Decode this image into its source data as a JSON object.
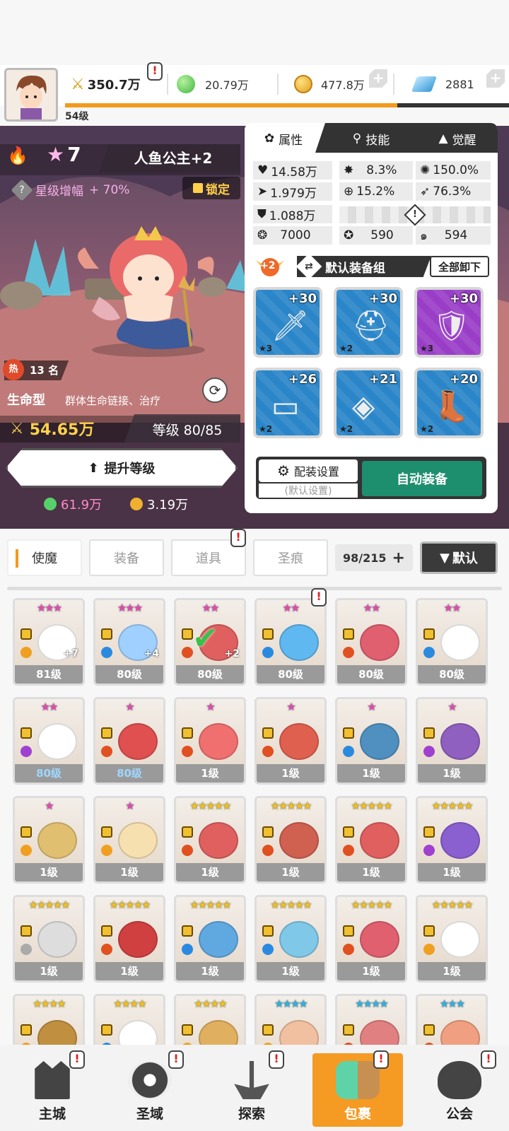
{
  "header": {
    "player_level": "54级",
    "power": "350.7万",
    "green_gem": "20.79万",
    "gold": "477.8万",
    "crystal": "2881",
    "xp_progress": 0.75,
    "accent_color": "#f39a1c"
  },
  "hero": {
    "stars": "7",
    "name": "人鱼公主+2",
    "star_boost_label": "星级增幅",
    "star_boost_value": "+ 70%",
    "lock_label": "锁定",
    "hot_label": "热",
    "hot_rank": "13 名",
    "type": "生命型",
    "description": "群体生命链接、治疗",
    "power": "54.65万",
    "level_label": "等级 80/85",
    "upgrade_label": "提升等级",
    "upgrade_cost_green": "61.9万",
    "upgrade_cost_gold": "3.19万"
  },
  "panel": {
    "tabs": [
      "属性",
      "技能",
      "觉醒"
    ],
    "stats": {
      "hp": "14.58万",
      "crit": "8.3%",
      "crit_dmg": "150.0%",
      "attack": "1.979万",
      "accuracy": "15.2%",
      "speed": "76.3%",
      "defense": "1.088万",
      "s1": "7000",
      "s2": "590",
      "s3": "594"
    },
    "equip_plus": "+2",
    "equip_group": "默认装备组",
    "unequip_all": "全部卸下",
    "slots": [
      {
        "level": "+30",
        "stars": "★3",
        "icon": "sword-icon",
        "color": "blue"
      },
      {
        "level": "+30",
        "stars": "★2",
        "icon": "helmet-icon",
        "color": "blue"
      },
      {
        "level": "+30",
        "stars": "★3",
        "icon": "armor-icon",
        "color": "purple"
      },
      {
        "level": "+26",
        "stars": "★2",
        "icon": "belt-icon",
        "color": "blue"
      },
      {
        "level": "+21",
        "stars": "★2",
        "icon": "necklace-icon",
        "color": "blue"
      },
      {
        "level": "+20",
        "stars": "★2",
        "icon": "boots-icon",
        "color": "blue"
      }
    ],
    "config_label": "配装设置",
    "config_sub": "(默认设置)",
    "auto_equip": "自动装备"
  },
  "category_tabs": [
    "使魔",
    "装备",
    "道具",
    "圣痕"
  ],
  "inventory_count": "98/215",
  "sort_label": "默认",
  "cards": [
    {
      "lv": "81级",
      "stars": "★★★",
      "star_color": "#e04ab0",
      "plus": "+7",
      "elem": "#f0a020",
      "face": "#ffffff"
    },
    {
      "lv": "80级",
      "stars": "★★★",
      "star_color": "#e04ab0",
      "plus": "+4",
      "elem": "#2a8ae0",
      "face": "#9fd0ff"
    },
    {
      "lv": "80级",
      "stars": "★★",
      "star_color": "#e04ab0",
      "plus": "+2",
      "elem": "#e05020",
      "face": "#e06060"
    },
    {
      "lv": "80级",
      "stars": "★★",
      "star_color": "#e04ab0",
      "plus": "",
      "elem": "#2a8ae0",
      "face": "#60b8f0"
    },
    {
      "lv": "80级",
      "stars": "★★",
      "star_color": "#e04ab0",
      "plus": "",
      "elem": "#e05020",
      "face": "#e06070"
    },
    {
      "lv": "80级",
      "stars": "★★",
      "star_color": "#e04ab0",
      "plus": "",
      "elem": "#2a8ae0",
      "face": "#ffffff"
    },
    {
      "lv": "80级",
      "stars": "★★",
      "star_color": "#e04ab0",
      "plus": "",
      "elem": "#a040d0",
      "face": "#ffffff",
      "blue": true
    },
    {
      "lv": "80级",
      "stars": "★",
      "star_color": "#e04ab0",
      "plus": "",
      "elem": "#e05020",
      "face": "#e05050",
      "blue": true
    },
    {
      "lv": "1级",
      "stars": "★",
      "star_color": "#e04ab0",
      "plus": "",
      "elem": "#e05020",
      "face": "#f07070"
    },
    {
      "lv": "1级",
      "stars": "★",
      "star_color": "#e04ab0",
      "plus": "",
      "elem": "#e05020",
      "face": "#e06050"
    },
    {
      "lv": "1级",
      "stars": "★",
      "star_color": "#e04ab0",
      "plus": "",
      "elem": "#2a8ae0",
      "face": "#5090c0"
    },
    {
      "lv": "1级",
      "stars": "★",
      "star_color": "#e04ab0",
      "plus": "",
      "elem": "#a040d0",
      "face": "#9060c0"
    },
    {
      "lv": "1级",
      "stars": "★",
      "star_color": "#e04ab0",
      "plus": "",
      "elem": "#f0a020",
      "face": "#e0c070"
    },
    {
      "lv": "1级",
      "stars": "★",
      "star_color": "#e04ab0",
      "plus": "",
      "elem": "#f0a020",
      "face": "#f6e0b0"
    },
    {
      "lv": "1级",
      "stars": "★★★★★",
      "star_color": "#f0c020",
      "plus": "",
      "elem": "#e05020",
      "face": "#e06060"
    },
    {
      "lv": "1级",
      "stars": "★★★★★",
      "star_color": "#f0c020",
      "plus": "",
      "elem": "#e05020",
      "face": "#d06050"
    },
    {
      "lv": "1级",
      "stars": "★★★★★",
      "star_color": "#f0c020",
      "plus": "",
      "elem": "#e05020",
      "face": "#e06060"
    },
    {
      "lv": "1级",
      "stars": "★★★★★",
      "star_color": "#f0c020",
      "plus": "",
      "elem": "#a040d0",
      "face": "#8a60d0"
    },
    {
      "lv": "1级",
      "stars": "★★★★★",
      "star_color": "#f0c020",
      "plus": "",
      "elem": "#aaaaaa",
      "face": "#dddddd"
    },
    {
      "lv": "1级",
      "stars": "★★★★★",
      "star_color": "#f0c020",
      "plus": "",
      "elem": "#e05020",
      "face": "#d04040"
    },
    {
      "lv": "1级",
      "stars": "★★★★★",
      "star_color": "#f0c020",
      "plus": "",
      "elem": "#2a8ae0",
      "face": "#60a8e0"
    },
    {
      "lv": "1级",
      "stars": "★★★★★",
      "star_color": "#f0c020",
      "plus": "",
      "elem": "#2a8ae0",
      "face": "#80c8e8"
    },
    {
      "lv": "1级",
      "stars": "★★★★★",
      "star_color": "#f0c020",
      "plus": "",
      "elem": "#e05020",
      "face": "#e06070"
    },
    {
      "lv": "1级",
      "stars": "★★★★★",
      "star_color": "#f0c020",
      "plus": "",
      "elem": "#f0a020",
      "face": "#ffffff"
    },
    {
      "lv": "",
      "stars": "★★★★",
      "star_color": "#f0c020",
      "plus": "",
      "elem": "#f0a020",
      "face": "#c09040"
    },
    {
      "lv": "",
      "stars": "★★★★",
      "star_color": "#f0c020",
      "plus": "",
      "elem": "#2a8ae0",
      "face": "#ffffff"
    },
    {
      "lv": "",
      "stars": "★★★★",
      "star_color": "#f0c020",
      "plus": "",
      "elem": "#f0a020",
      "face": "#e0b060"
    },
    {
      "lv": "",
      "stars": "★★★★",
      "star_color": "#30b0e0",
      "plus": "",
      "elem": "#f0a020",
      "face": "#f0c0a0"
    },
    {
      "lv": "",
      "stars": "★★★★",
      "star_color": "#30b0e0",
      "plus": "",
      "elem": "#e05020",
      "face": "#e08080"
    },
    {
      "lv": "",
      "stars": "★★★",
      "star_color": "#30b0e0",
      "plus": "",
      "elem": "#e05020",
      "face": "#f0a080"
    }
  ],
  "nav": [
    "主城",
    "圣域",
    "探索",
    "包裹",
    "公会"
  ]
}
